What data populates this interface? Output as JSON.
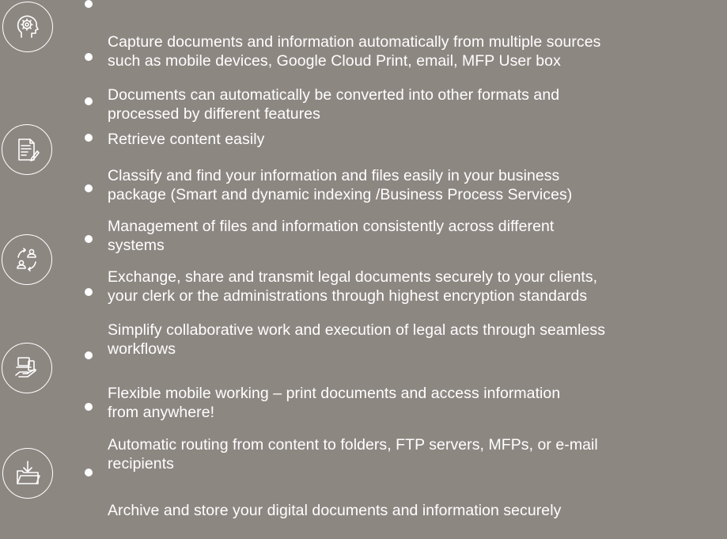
{
  "groups": [
    {
      "icon": "brain-head-icon",
      "bullets": [
        "Capture documents and information automatically from multiple sources\n such as mobile devices, Google Cloud Print, email, MFP User box",
        "Documents can automatically be converted into other formats  and\nprocessed by different features",
        "Retrieve content easily"
      ]
    },
    {
      "icon": "document-pen-icon",
      "bullets": [
        "Classify and find your information and files easily in your business\n package (Smart and dynamic indexing /Business Process Services)",
        "Management of files and information consistently across different\nsystems"
      ]
    },
    {
      "icon": "people-exchange-icon",
      "bullets": [
        "Exchange, share and transmit legal documents securely to your clients,\n your clerk or the administrations through highest encryption standards",
        "Simplify collaborative work and execution of legal acts through seamless\nworkflows"
      ]
    },
    {
      "icon": "devices-hand-icon",
      "bullets": [
        "Flexible mobile working – print documents and access information\n from anywhere!",
        "Automatic routing from content to folders, FTP servers, MFPs, or e-mail\nrecipients"
      ]
    },
    {
      "icon": "folder-download-icon",
      "bullets": [
        "Archive and store your digital documents and information securely"
      ]
    }
  ]
}
